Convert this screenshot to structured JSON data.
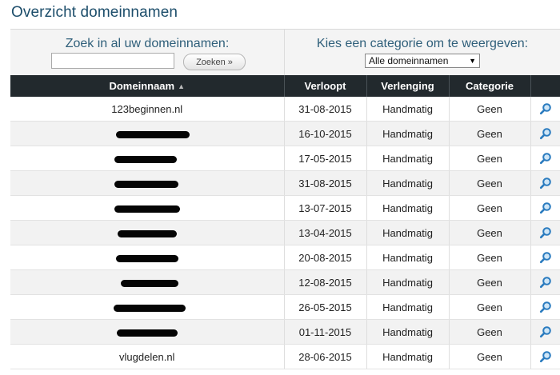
{
  "page": {
    "title": "Overzicht domeinnamen"
  },
  "search": {
    "label": "Zoek in al uw domeinnamen:",
    "value": "",
    "button_label": "Zoeken »"
  },
  "category_filter": {
    "label": "Kies een categorie om te weergeven:",
    "selected": "Alle domeinnamen"
  },
  "table": {
    "columns": [
      "Domeinnaam",
      "Verloopt",
      "Verlenging",
      "Categorie",
      ""
    ],
    "rows": [
      {
        "domain": "123beginnen.nl",
        "redacted": false,
        "expires": "31-08-2015",
        "renewal": "Handmatig",
        "category": "Geen"
      },
      {
        "domain": "",
        "redacted": true,
        "expires": "16-10-2015",
        "renewal": "Handmatig",
        "category": "Geen"
      },
      {
        "domain": "",
        "redacted": true,
        "expires": "17-05-2015",
        "renewal": "Handmatig",
        "category": "Geen"
      },
      {
        "domain": "",
        "redacted": true,
        "expires": "31-08-2015",
        "renewal": "Handmatig",
        "category": "Geen"
      },
      {
        "domain": "",
        "redacted": true,
        "expires": "13-07-2015",
        "renewal": "Handmatig",
        "category": "Geen"
      },
      {
        "domain": "",
        "redacted": true,
        "expires": "13-04-2015",
        "renewal": "Handmatig",
        "category": "Geen"
      },
      {
        "domain": "",
        "redacted": true,
        "expires": "20-08-2015",
        "renewal": "Handmatig",
        "category": "Geen"
      },
      {
        "domain": "",
        "redacted": true,
        "expires": "12-08-2015",
        "renewal": "Handmatig",
        "category": "Geen"
      },
      {
        "domain": "",
        "redacted": true,
        "expires": "26-05-2015",
        "renewal": "Handmatig",
        "category": "Geen"
      },
      {
        "domain": "",
        "redacted": true,
        "expires": "01-11-2015",
        "renewal": "Handmatig",
        "category": "Geen"
      },
      {
        "domain": "vlugdelen.nl",
        "redacted": false,
        "expires": "28-06-2015",
        "renewal": "Handmatig",
        "category": "Geen"
      }
    ],
    "row_action_icon": "magnifier-icon"
  },
  "colors": {
    "title": "#1d4e6b",
    "header_bg": "#22292d",
    "icon_blue": "#2a7bbf"
  }
}
